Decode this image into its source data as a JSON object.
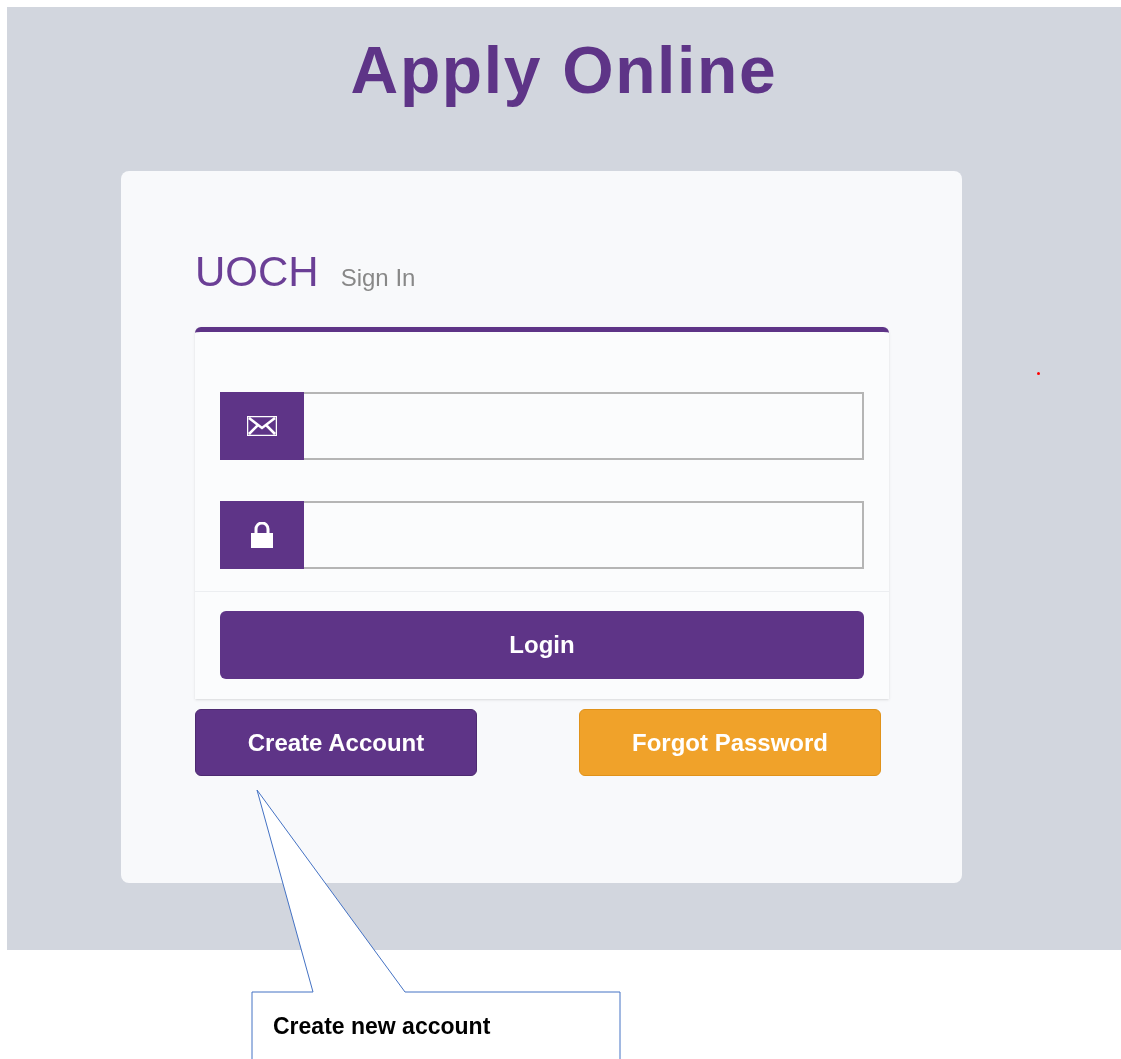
{
  "page_title": "Apply Online",
  "login_card": {
    "brand": "UOCH",
    "subtitle": "Sign In",
    "fields": [
      {
        "kind": "email"
      },
      {
        "kind": "password"
      }
    ],
    "login_button": "Login",
    "actions": [
      {
        "label": "Create Account",
        "kind": "primary"
      },
      {
        "label": "Forgot Password",
        "kind": "warning"
      }
    ]
  },
  "callout": {
    "text": "Create new account"
  }
}
